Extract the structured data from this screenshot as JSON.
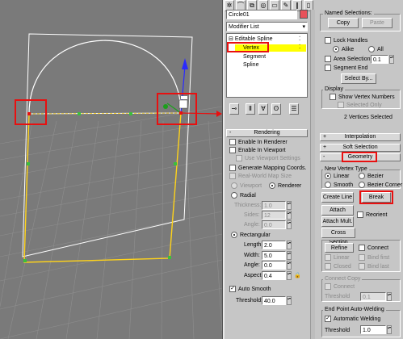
{
  "colors": {
    "viewport_bg": "#7a7a7a",
    "shape": "#ffd31a",
    "vertex": "#3bbf3b",
    "selected_vertex": "#e81010",
    "highlight": "#ffff00"
  },
  "object": {
    "name": "Circle01",
    "color": "#e8525a"
  },
  "modifier_list": {
    "label": "Modifier List"
  },
  "stack": {
    "root": "Editable Spline",
    "items": [
      "Vertex",
      "Segment",
      "Spline"
    ],
    "selected": "Vertex"
  },
  "rendering": {
    "title": "Rendering",
    "enable_renderer": "Enable In Renderer",
    "enable_viewport": "Enable In Viewport",
    "use_viewport_settings": "Use Viewport Settings",
    "generate_mapping": "Generate Mapping Coords.",
    "real_world_map": "Real-World Map Size",
    "viewport": "Viewport",
    "renderer": "Renderer",
    "radial": "Radial",
    "thickness_label": "Thickness:",
    "thickness_value": "1.0",
    "sides_label": "Sides:",
    "sides_value": "12",
    "angle_label": "Angle:",
    "angle_value": "0.0",
    "rectangular": "Rectangular",
    "length_label": "Length:",
    "length_value": "2.0",
    "width_label": "Width:",
    "width_value": "5.0",
    "rect_angle_label": "Angle:",
    "rect_angle_value": "0.0",
    "aspect_label": "Aspect:",
    "aspect_value": "0.4",
    "auto_smooth": "Auto Smooth",
    "threshold_label": "Threshold:",
    "threshold_value": "40.0"
  },
  "selection": {
    "named_title": "Named Selections:",
    "copy": "Copy",
    "paste": "Paste",
    "lock_handles": "Lock Handles",
    "alike": "Alike",
    "all": "All",
    "area_selection": "Area Selection:",
    "area_value": "0.1",
    "segment_end": "Segment End",
    "select_by": "Select By...",
    "display_title": "Display",
    "show_vertex_numbers": "Show Vertex Numbers",
    "selected_only": "Selected Only",
    "status": "2 Vertices Selected"
  },
  "rollouts": {
    "interpolation": "Interpolation",
    "soft_selection": "Soft Selection",
    "geometry": "Geometry"
  },
  "geometry": {
    "new_vertex_type": "New Vertex Type",
    "linear": "Linear",
    "bezier": "Bezier",
    "smooth": "Smooth",
    "bezier_corner": "Bezier Corner",
    "create_line": "Create Line",
    "break": "Break",
    "attach": "Attach",
    "attach_mult": "Attach Mult.",
    "reorient": "Reorient",
    "cross_section": "Cross Section",
    "refine": "Refine",
    "connect": "Connect",
    "linear_cb": "Linear",
    "bind_first": "Bind first",
    "closed": "Closed",
    "bind_last": "Bind last",
    "connect_copy": "Connect Copy",
    "connect_cb": "Connect",
    "cc_threshold_label": "Threshold",
    "cc_threshold_value": "0.1",
    "end_point_welding": "End Point Auto-Welding",
    "automatic_welding": "Automatic Welding",
    "ep_threshold_label": "Threshold",
    "ep_threshold_value": "1.0"
  }
}
